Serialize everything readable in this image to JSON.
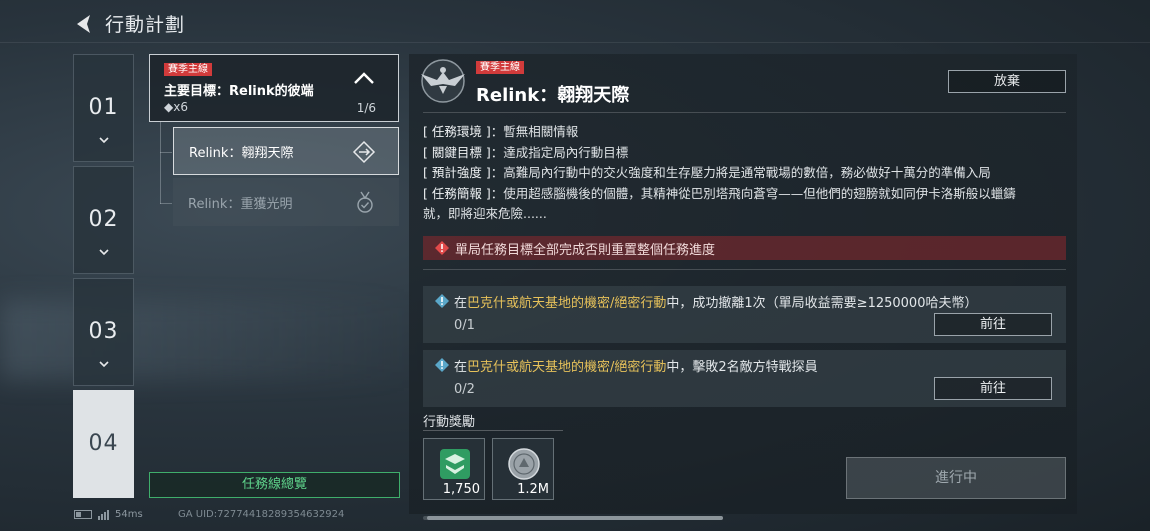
{
  "header": {
    "title": "行動計劃"
  },
  "chapters": [
    {
      "label": "01",
      "active": false
    },
    {
      "label": "02",
      "active": false
    },
    {
      "label": "03",
      "active": false
    },
    {
      "label": "04",
      "active": true
    }
  ],
  "mission_list": {
    "main": {
      "tag": "賽季主線",
      "title": "主要目標：Relink的彼端",
      "reward": "◆x6",
      "progress": "1/6"
    },
    "subs": [
      {
        "label": "Relink：翱翔天際",
        "state": "active"
      },
      {
        "label": "Relink：重獲光明",
        "state": "inactive"
      }
    ],
    "overview_button": "任務線總覽"
  },
  "status_bar": {
    "ping": "54ms",
    "uid": "GA UID:72774418289354632924"
  },
  "detail": {
    "tag": "賽季主線",
    "title": "Relink：翱翔天際",
    "abandon_button": "放棄",
    "info": [
      {
        "key": "[ 任務環境 ]",
        "value": "：暫無相關情報"
      },
      {
        "key": "[ 關鍵目標 ]",
        "value": "：達成指定局內行動目標"
      },
      {
        "key": "[ 預計強度 ]",
        "value": "：高難局內行動中的交火強度和生存壓力將是通常戰場的數倍，務必做好十萬分的準備入局"
      },
      {
        "key": "[ 任務簡報 ]",
        "value": "：使用超感腦機後的個體，其精神從巴別塔飛向蒼穹——但他們的翅膀就如同伊卡洛斯般以蠟鑄"
      }
    ],
    "info_continuation": "就，即將迎來危險......",
    "warning": "單局任務目標全部完成否則重置整個任務進度",
    "tasks": [
      {
        "prefix": "在",
        "highlight": "巴克什或航天基地的機密/絕密行動",
        "suffix": "中，成功撤離1次（單局收益需要≥1250000哈夫幣）",
        "progress": "0/1",
        "button": "前往"
      },
      {
        "prefix": "在",
        "highlight": "巴克什或航天基地的機密/絕密行動",
        "suffix": "中，擊敗2名敵方特戰探員",
        "progress": "0/2",
        "button": "前往"
      }
    ],
    "rewards_title": "行動獎勵",
    "rewards": [
      {
        "icon": "green-emblem-icon",
        "qty": "1,750"
      },
      {
        "icon": "silver-coin-icon",
        "qty": "1.2M"
      }
    ],
    "status_button": "進行中"
  },
  "colors": {
    "tag_red": "#d13b3b",
    "highlight": "#e7c25a",
    "overview_green": "#3fae6b",
    "warning_bg": "#8c282d"
  }
}
